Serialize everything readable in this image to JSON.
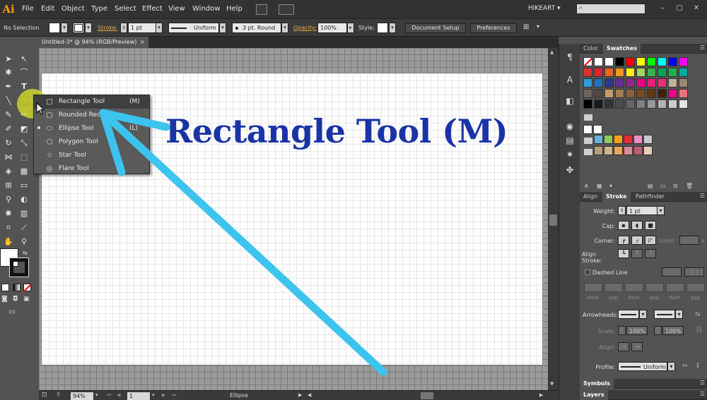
{
  "app": {
    "logo": "Ai",
    "menu": [
      "File",
      "Edit",
      "Object",
      "Type",
      "Select",
      "Effect",
      "View",
      "Window",
      "Help"
    ],
    "workspace": "HIKEART",
    "workspace_caret": "▾"
  },
  "control_bar": {
    "selection": "No Selection",
    "stroke_label": "Stroke:",
    "stroke_value": "1 pt",
    "profile_value": "Uniform",
    "brush_value": "3 pt. Round",
    "opacity_label": "Opacity:",
    "opacity_value": "100%",
    "style_label": "Style:",
    "document_setup": "Document Setup",
    "preferences": "Preferences"
  },
  "document": {
    "tab_title": "Untitled-3* @ 94% (RGB/Preview)",
    "close": "×",
    "canvas_text": "Rectangle Tool (M)"
  },
  "flyout": {
    "items": [
      {
        "label": "Rectangle Tool",
        "key": "(M)",
        "icon": "□"
      },
      {
        "label": "Rounded Rect",
        "key": "",
        "icon": "▢"
      },
      {
        "label": "Ellipse Tool",
        "key": "(L)",
        "icon": "⬭"
      },
      {
        "label": "Polygon Tool",
        "key": "",
        "icon": "⬡"
      },
      {
        "label": "Star Tool",
        "key": "",
        "icon": "☆"
      },
      {
        "label": "Flare Tool",
        "key": "",
        "icon": "◎"
      }
    ]
  },
  "status": {
    "zoom": "94%",
    "page": "1",
    "tool": "Ellipse"
  },
  "panels": {
    "color_tabs": [
      "Color",
      "Swatches"
    ],
    "stroke_tabs": [
      "Align",
      "Stroke",
      "Pathfinder"
    ],
    "weight_label": "Weight:",
    "weight_value": "1 pt",
    "cap_label": "Cap:",
    "corner_label": "Corner:",
    "limit_label": "Limit:",
    "limit_mark": "x",
    "align_stroke_label": "Align Stroke:",
    "dashed_line_label": "Dashed Line",
    "dash_labels": [
      "dash",
      "gap",
      "dash",
      "gap",
      "dash",
      "gap"
    ],
    "arrowheads_label": "Arrowheads:",
    "scale_label": "Scale:",
    "scale_1": "100%",
    "scale_2": "100%",
    "align_label": "Align:",
    "profile_label": "Profile:",
    "profile_value": "Uniform",
    "symbols": "Symbols",
    "layers": "Layers"
  },
  "colors": {
    "accent_title": "#1a33a6",
    "arrow": "#3cc3ee",
    "highlight": "#dce628",
    "stroke_label_orange": "#e7a44b"
  },
  "swatches": [
    [
      "#ffffff",
      "#ffffff",
      "#ffffff",
      "#000000",
      "#ff0000",
      "#ffff00",
      "#00ff00",
      "#00ffff",
      "#0000ff",
      "#ff00ff"
    ],
    [
      "#e03131",
      "#e0242f",
      "#f26522",
      "#f7941d",
      "#fff200",
      "#a3d55e",
      "#39b54a",
      "#00a651",
      "#1cb34a",
      "#00a99d"
    ],
    [
      "#2e9fd9",
      "#1c75bc",
      "#2b3990",
      "#662d91",
      "#92278f",
      "#ec008c",
      "#ed1c79",
      "#ee2a7b",
      "#c2b49a",
      "#998675"
    ],
    [
      "#736357",
      "#534741",
      "#c69c6d",
      "#a67c52",
      "#8c6239",
      "#754c24",
      "#603913",
      "#42210b",
      "#ec008c",
      "#f26d7d"
    ],
    [
      "#000000",
      "#1a1a1a",
      "#333333",
      "#4d4d4d",
      "#666666",
      "#808080",
      "#999999",
      "#b3b3b3",
      "#cccccc",
      "#e6e6e6"
    ]
  ]
}
